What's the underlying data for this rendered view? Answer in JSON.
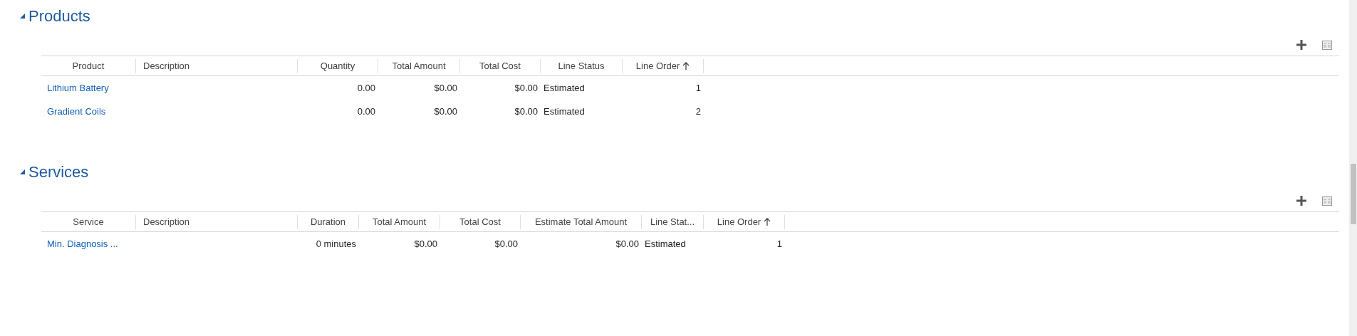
{
  "sections": [
    {
      "title": "Products",
      "expanded": true,
      "columns": [
        {
          "label": "Product",
          "sorted": false
        },
        {
          "label": "Description",
          "sorted": false
        },
        {
          "label": "Quantity",
          "sorted": false
        },
        {
          "label": "Total Amount",
          "sorted": false
        },
        {
          "label": "Total Cost",
          "sorted": false
        },
        {
          "label": "Line Status",
          "sorted": false
        },
        {
          "label": "Line Order",
          "sorted": true
        }
      ],
      "rows": [
        [
          "Lithium Battery",
          "",
          "0.00",
          "$0.00",
          "$0.00",
          "Estimated",
          "1"
        ],
        [
          "Gradient Coils",
          "",
          "0.00",
          "$0.00",
          "$0.00",
          "Estimated",
          "2"
        ]
      ]
    },
    {
      "title": "Services",
      "expanded": true,
      "columns": [
        {
          "label": "Service",
          "sorted": false
        },
        {
          "label": "Description",
          "sorted": false
        },
        {
          "label": "Duration",
          "sorted": false
        },
        {
          "label": "Total Amount",
          "sorted": false
        },
        {
          "label": "Total Cost",
          "sorted": false
        },
        {
          "label": "Estimate Total Amount",
          "sorted": false
        },
        {
          "label": "Line Stat...",
          "sorted": false
        },
        {
          "label": "Line Order",
          "sorted": true
        }
      ],
      "rows": [
        [
          "Min. Diagnosis ...",
          "",
          "0 minutes",
          "$0.00",
          "$0.00",
          "$0.00",
          "Estimated",
          "1"
        ]
      ]
    }
  ]
}
